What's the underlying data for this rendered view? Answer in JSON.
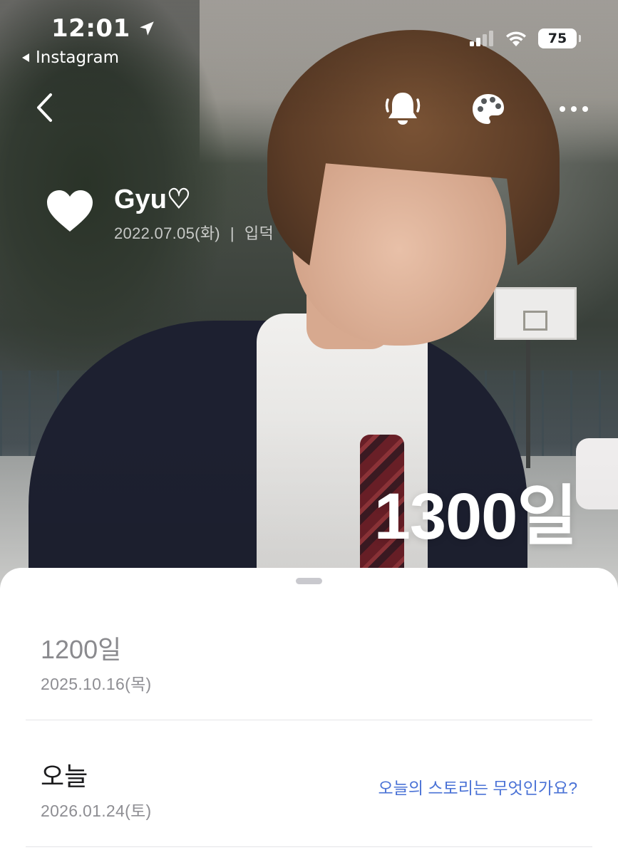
{
  "status_bar": {
    "time": "12:01",
    "back_app": "Instagram",
    "battery": "75"
  },
  "toolbar": {
    "icons": [
      "chevron-left-icon",
      "bell-icon",
      "palette-icon",
      "more-icon"
    ]
  },
  "profile": {
    "name": "Gyu♡",
    "date": "2022.07.05(화)",
    "separator": "|",
    "event": "입덕"
  },
  "counter": {
    "label": "1300일"
  },
  "milestones": [
    {
      "title": "1200일",
      "date": "2025.10.16(목)"
    },
    {
      "title": "오늘",
      "date": "2026.01.24(토)",
      "link": "오늘의 스토리는 무엇인가요?"
    }
  ],
  "colors": {
    "accent_link": "#4a72d6",
    "sheet_bg": "#ffffff",
    "muted_text": "#8e8e93"
  }
}
